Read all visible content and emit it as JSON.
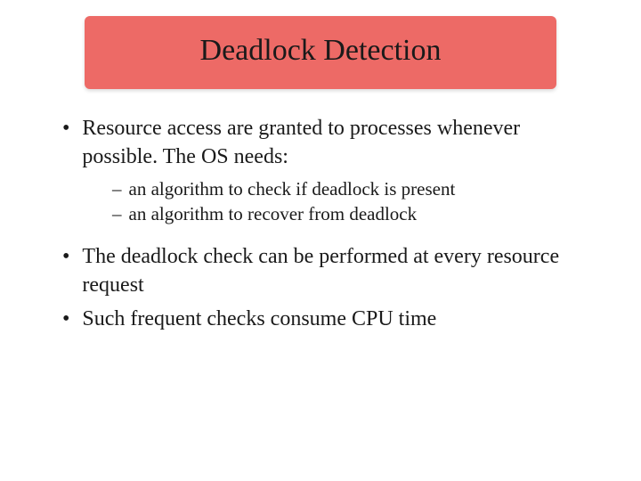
{
  "slide": {
    "title": "Deadlock Detection",
    "bullets": [
      {
        "text": "Resource access are granted to processes whenever possible. The OS needs:",
        "subs": [
          "an algorithm to check if deadlock is present",
          "an algorithm to recover from deadlock"
        ]
      },
      {
        "text": "The deadlock check can be performed at every resource request",
        "subs": []
      },
      {
        "text": "Such frequent checks consume CPU time",
        "subs": []
      }
    ]
  }
}
